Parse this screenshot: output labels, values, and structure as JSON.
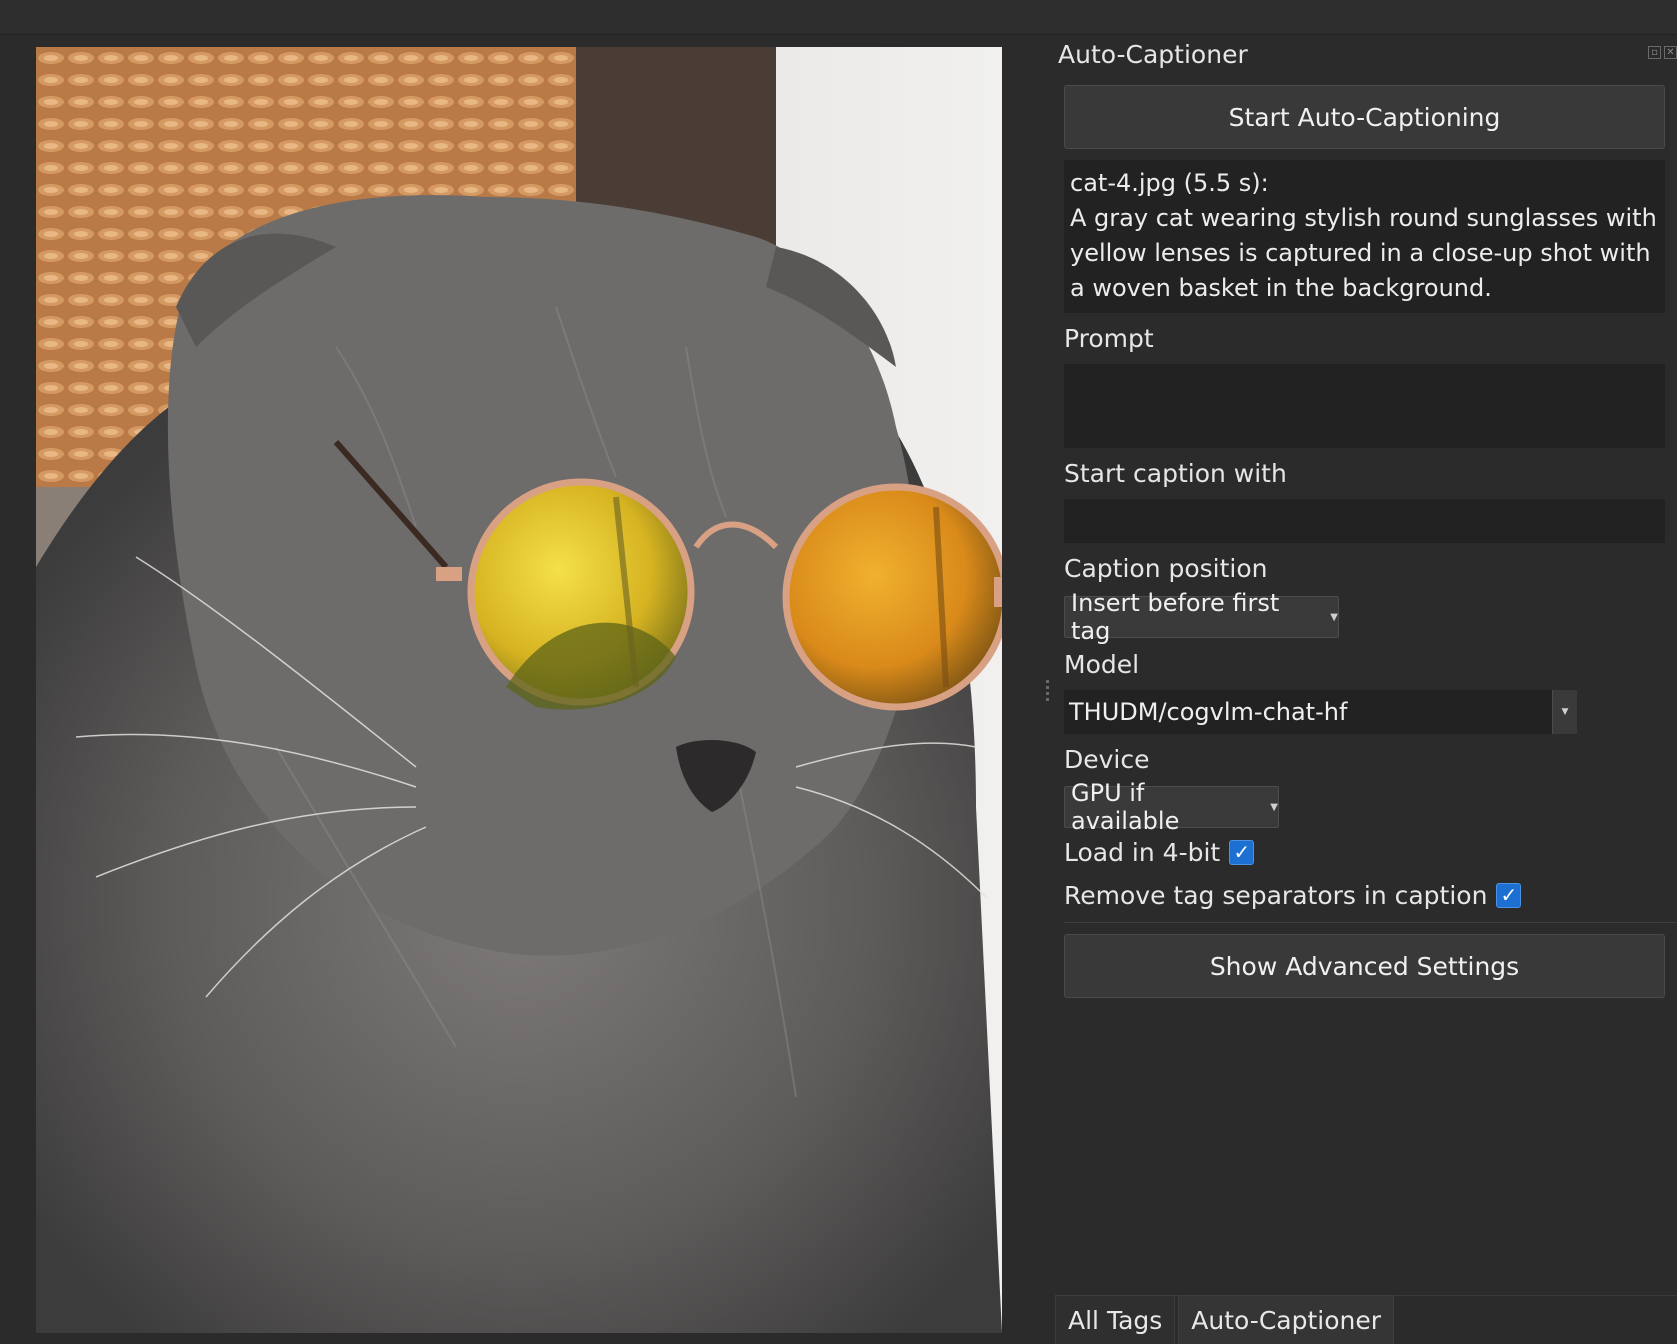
{
  "dock": {
    "title": "Auto-Captioner",
    "start_button": "Start Auto-Captioning",
    "result": {
      "header": "cat-4.jpg (5.5 s):",
      "caption": "A gray cat wearing stylish round sunglasses with yellow lenses is captured in a close-up shot with a woven basket in the background."
    },
    "prompt_label": "Prompt",
    "prompt_value": "",
    "start_caption_label": "Start caption with",
    "start_caption_value": "",
    "caption_position_label": "Caption position",
    "caption_position_value": "Insert before first tag",
    "model_label": "Model",
    "model_value": "THUDM/cogvlm-chat-hf",
    "device_label": "Device",
    "device_value": "GPU if available",
    "load_4bit_label": "Load in 4-bit",
    "load_4bit_checked": true,
    "remove_separators_label": "Remove tag separators in caption",
    "remove_separators_checked": true,
    "advanced_button": "Show Advanced Settings"
  },
  "tabs": [
    {
      "label": "All Tags",
      "active": false
    },
    {
      "label": "Auto-Captioner",
      "active": true
    }
  ],
  "icons": {
    "float": "float-icon",
    "close": "close-icon",
    "check": "checkmark-icon"
  },
  "colors": {
    "background": "#2b2b2b",
    "accent": "#1d6fd1"
  }
}
